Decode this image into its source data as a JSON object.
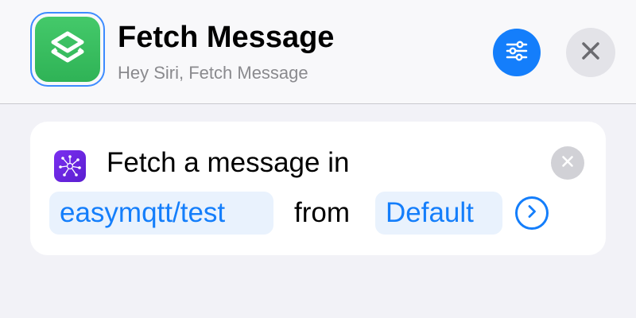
{
  "shortcut": {
    "title": "Fetch Message",
    "subtitle": "Hey Siri, Fetch Message",
    "icon": "shortcuts-layers-icon"
  },
  "header_buttons": {
    "settings_icon": "sliders-icon",
    "close_icon": "close-icon"
  },
  "action": {
    "icon": "mqtt-network-icon",
    "text": "Fetch a message in",
    "topic": "easymqtt/test",
    "connector": "from",
    "broker": "Default",
    "expand_icon": "chevron-right-circle-icon",
    "remove_icon": "close-icon"
  },
  "colors": {
    "accent": "#147efb",
    "app_icon_green": "#3cc163",
    "action_icon_purple": "#6a27e0",
    "background": "#f2f2f7"
  }
}
